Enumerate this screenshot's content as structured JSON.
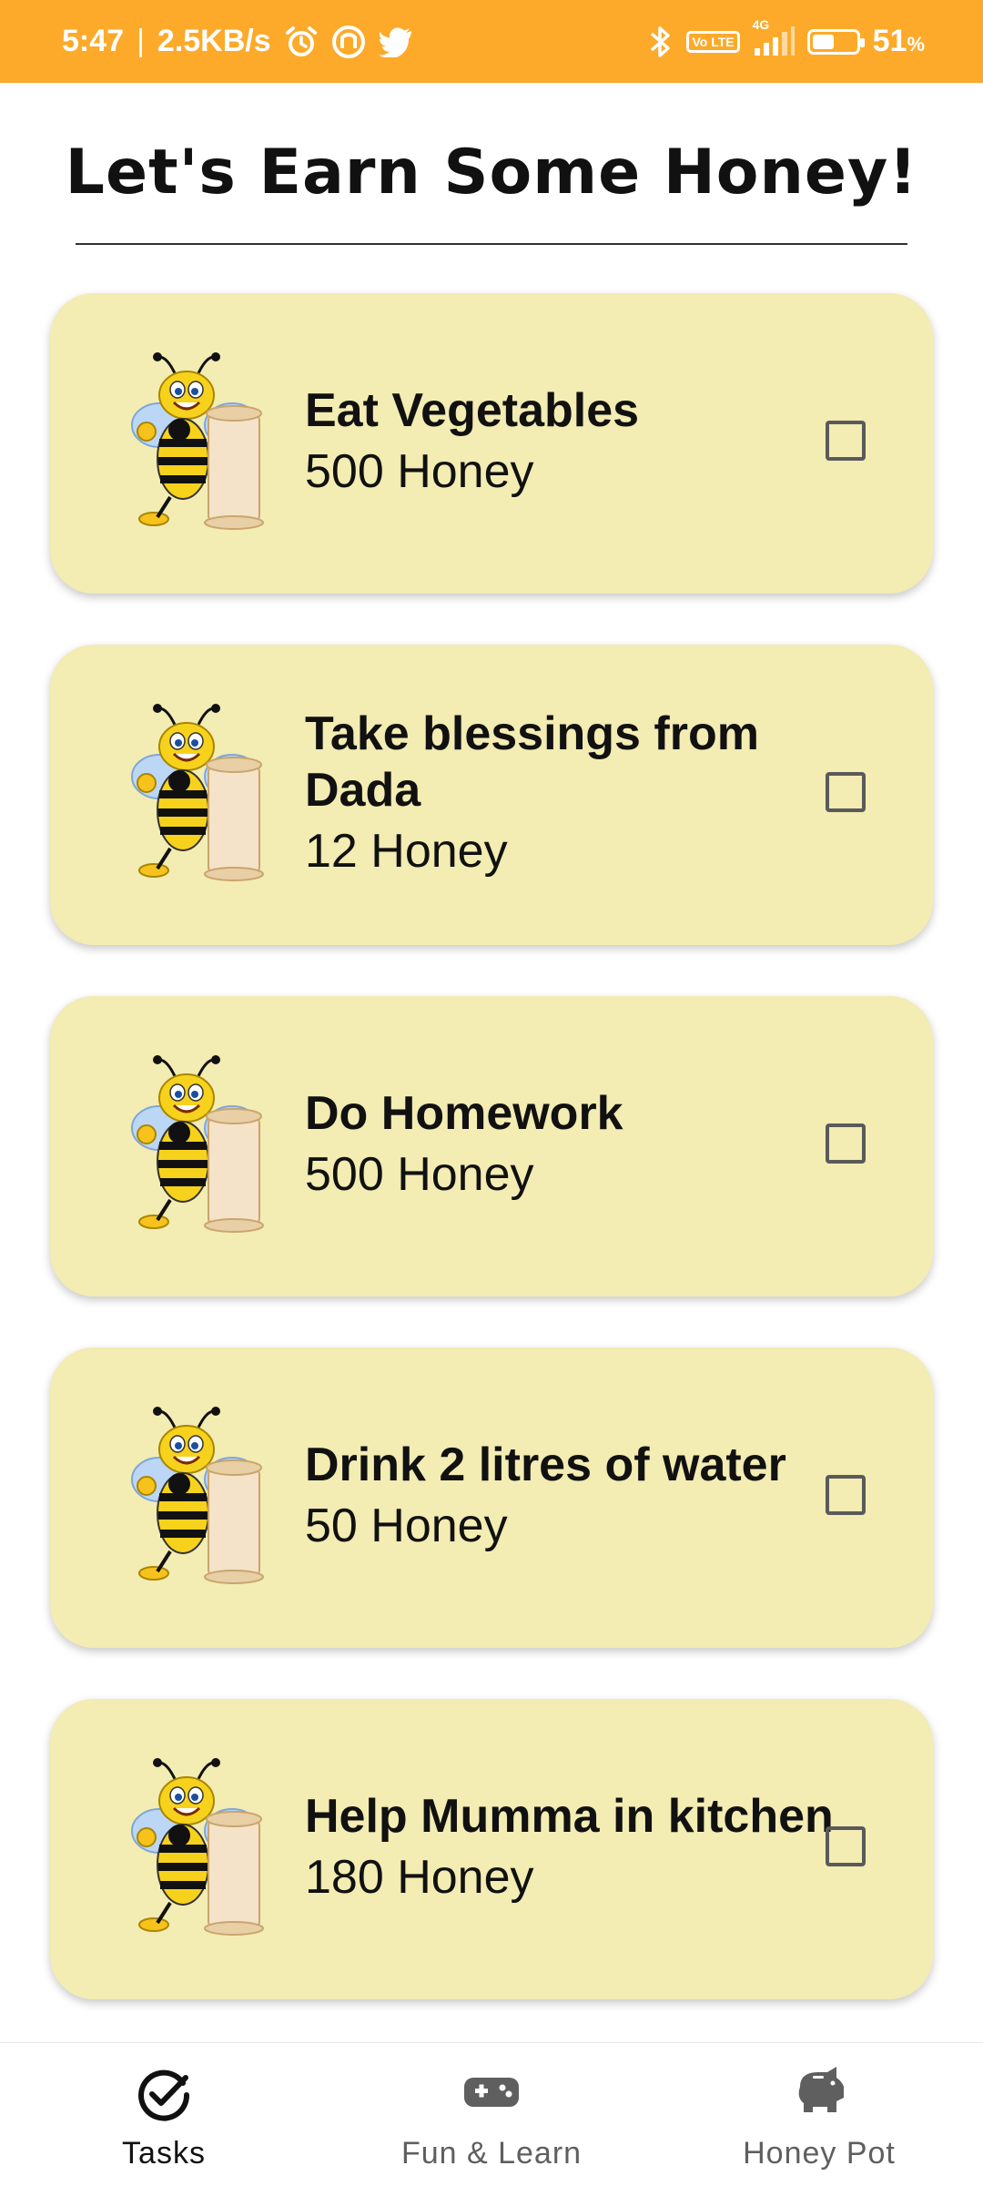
{
  "status_bar": {
    "time": "5:47",
    "separator": "|",
    "speed": "2.5KB/s",
    "battery_percent": "51",
    "battery_unit": "%",
    "volte_label": "Vo LTE",
    "network_label": "4G",
    "icons": [
      "alarm-icon",
      "app-icon",
      "twitter-icon",
      "bluetooth-icon",
      "volte-icon",
      "signal-icon",
      "battery-icon"
    ]
  },
  "header": {
    "title": "Let's Earn Some Honey!"
  },
  "tasks": [
    {
      "title": "Eat Vegetables",
      "reward": "500 Honey",
      "checked": false
    },
    {
      "title": "Take blessings from Dada",
      "reward": "12 Honey",
      "checked": false
    },
    {
      "title": "Do Homework",
      "reward": "500 Honey",
      "checked": false
    },
    {
      "title": "Drink 2 litres of water",
      "reward": "50 Honey",
      "checked": false
    },
    {
      "title": "Help Mumma in kitchen",
      "reward": "180 Honey",
      "checked": false
    }
  ],
  "bottom_nav": {
    "items": [
      {
        "label": "Tasks",
        "icon": "check-circle-icon",
        "active": true
      },
      {
        "label": "Fun & Learn",
        "icon": "gamepad-icon",
        "active": false
      },
      {
        "label": "Honey Pot",
        "icon": "piggy-bank-icon",
        "active": false
      }
    ]
  },
  "colors": {
    "status_bar": "#fdaa2a",
    "card_background": "#f3ecb3",
    "nav_active": "#111111",
    "nav_inactive": "#5f5f5f"
  }
}
